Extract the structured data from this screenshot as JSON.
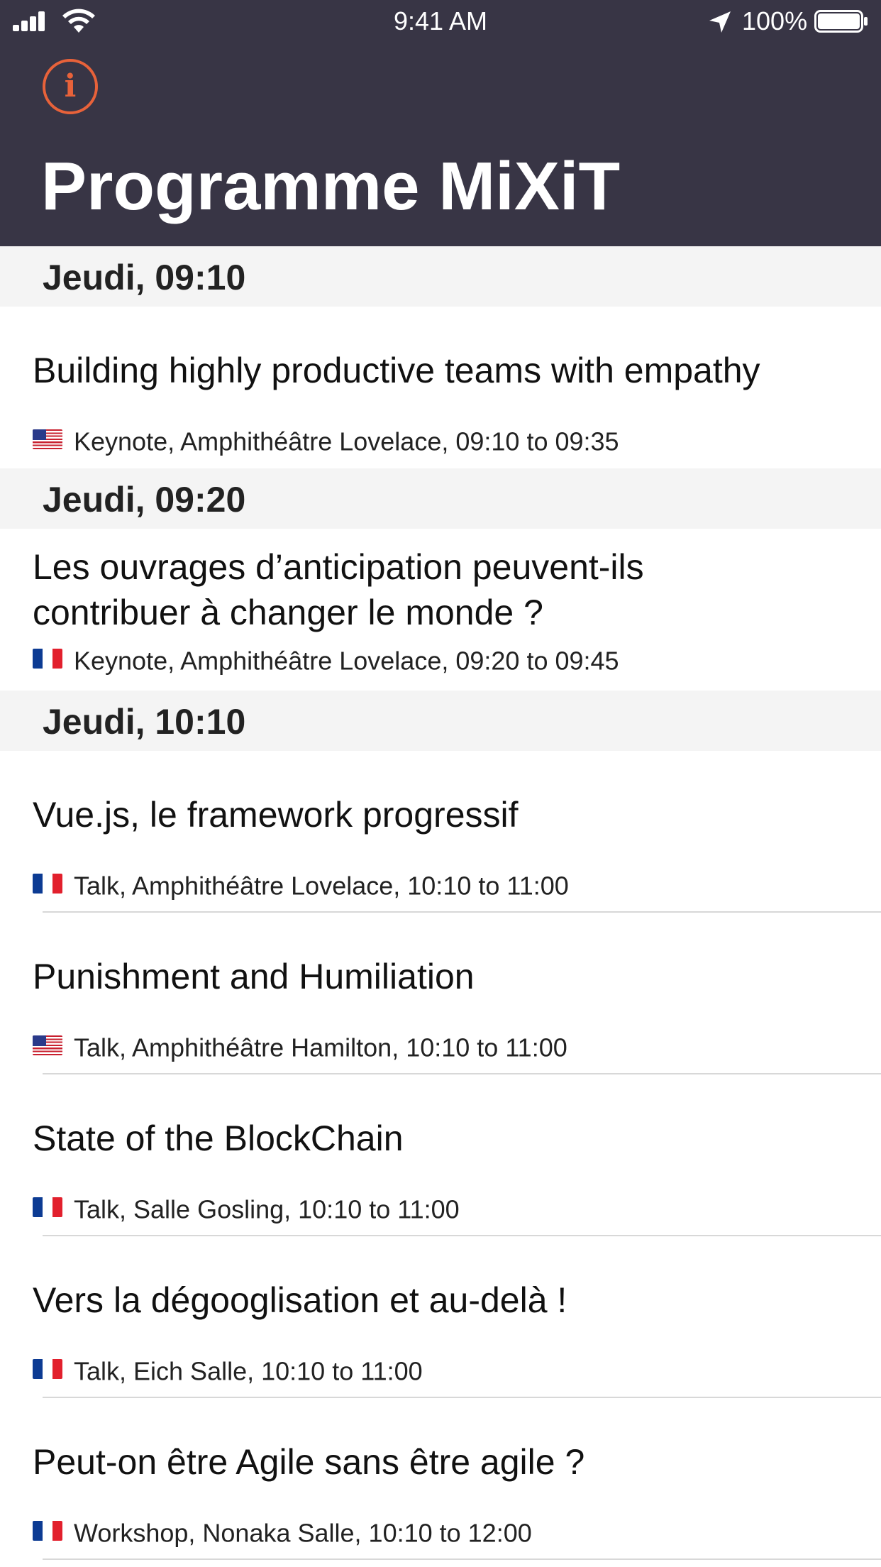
{
  "status_bar": {
    "time": "9:41 AM",
    "battery": "100%"
  },
  "header": {
    "info_icon": "i",
    "title": "Programme MiXiT"
  },
  "sections": [
    {
      "title": "Jeudi, 09:10",
      "sessions": [
        {
          "title": "Building highly productive teams with empathy",
          "lang": "en",
          "meta": "Keynote, Amphithéâtre Lovelace, 09:10 to 09:35"
        }
      ]
    },
    {
      "title": "Jeudi, 09:20",
      "sessions": [
        {
          "title": "Les ouvrages d’anticipation peuvent-ils contribuer à changer le monde ?",
          "lang": "fr",
          "meta": "Keynote, Amphithéâtre Lovelace, 09:20 to 09:45"
        }
      ]
    },
    {
      "title": "Jeudi, 10:10",
      "sessions": [
        {
          "title": "Vue.js, le framework progressif",
          "lang": "fr",
          "meta": "Talk, Amphithéâtre Lovelace, 10:10 to 11:00"
        },
        {
          "title": "Punishment and Humiliation",
          "lang": "en",
          "meta": "Talk, Amphithéâtre Hamilton, 10:10 to 11:00"
        },
        {
          "title": "State of the BlockChain",
          "lang": "fr",
          "meta": "Talk, Salle Gosling, 10:10 to 11:00"
        },
        {
          "title": "Vers la dégooglisation et au-delà !",
          "lang": "fr",
          "meta": "Talk, Eich Salle, 10:10 to 11:00"
        },
        {
          "title": "Peut-on être Agile sans être agile ?",
          "lang": "fr",
          "meta": "Workshop, Nonaka Salle, 10:10 to 12:00"
        }
      ]
    }
  ],
  "colors": {
    "header_bg": "#383545",
    "accent": "#e8623a",
    "section_bg": "#f4f4f4"
  }
}
